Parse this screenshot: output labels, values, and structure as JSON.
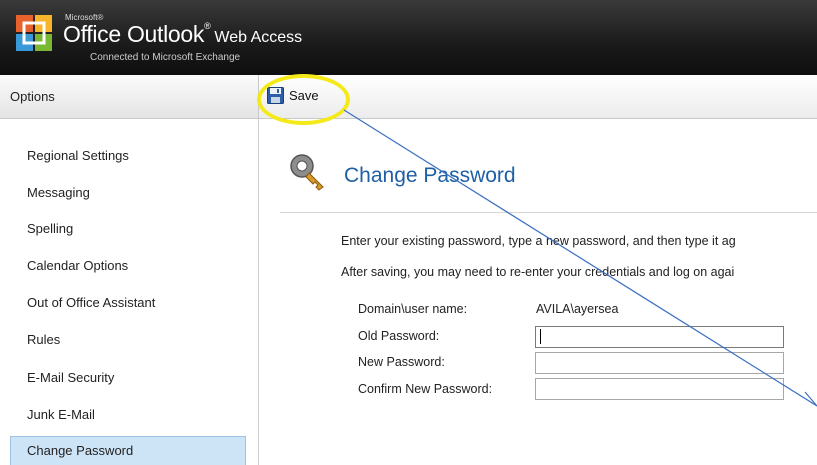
{
  "header": {
    "ms_small": "Microsoft®",
    "brand_main": "Office Outlook",
    "brand_tm": "®",
    "brand_suffix": "Web Access",
    "connected": "Connected to Microsoft Exchange"
  },
  "options_bar": {
    "title": "Options"
  },
  "toolbar": {
    "save_label": "Save"
  },
  "sidebar": {
    "items": [
      {
        "label": "Regional Settings"
      },
      {
        "label": "Messaging"
      },
      {
        "label": "Spelling"
      },
      {
        "label": "Calendar Options"
      },
      {
        "label": "Out of Office Assistant"
      },
      {
        "label": "Rules"
      },
      {
        "label": "E-Mail Security"
      },
      {
        "label": "Junk E-Mail"
      },
      {
        "label": "Change Password"
      }
    ],
    "selected": "Change Password"
  },
  "main": {
    "title": "Change Password",
    "instruction1": "Enter your existing password, type a new password, and then type it ag",
    "instruction2": "After saving, you may need to re-enter your credentials and log on agai",
    "domain_label": "Domain\\user name:",
    "domain_value": "AVILA\\ayersea",
    "old_password_label": "Old Password:",
    "new_password_label": "New Password:",
    "confirm_password_label": "Confirm New Password:",
    "old_password_value": "",
    "new_password_value": "",
    "confirm_password_value": ""
  },
  "colors": {
    "header_bg": "#1a1a1a",
    "title_blue": "#1f5fa5",
    "selected_bg": "#cde4f7",
    "highlight_yellow": "#f4ea1a",
    "annotation_line": "#3b6fc0"
  },
  "icons": [
    "office-logo-icon",
    "save-disk-icon",
    "key-icon"
  ]
}
